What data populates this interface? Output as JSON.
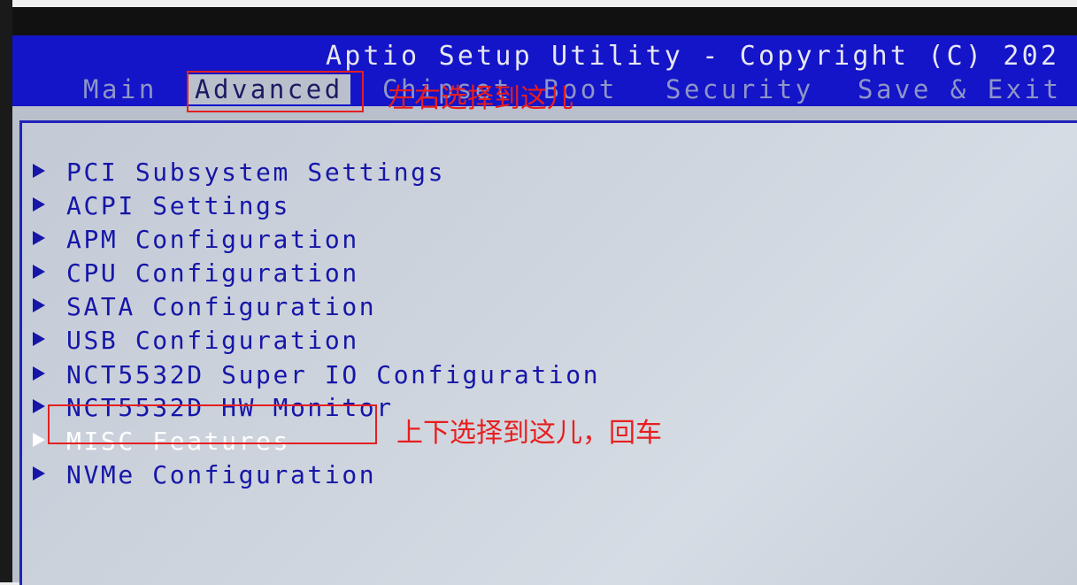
{
  "header": {
    "title": "Aptio Setup Utility - Copyright (C) 202"
  },
  "tabs": [
    "Main",
    "Advanced",
    "Chipset",
    "Boot",
    "Security",
    "Save & Exit"
  ],
  "menu": {
    "items": [
      "PCI Subsystem Settings",
      "ACPI Settings",
      "APM Configuration",
      "CPU Configuration",
      "SATA Configuration",
      "USB Configuration",
      "NCT5532D Super IO Configuration",
      "NCT5532D HW Monitor",
      "MISC Features",
      "NVMe Configuration"
    ],
    "selected_item": "MISC Features",
    "active_tab": "Advanced"
  },
  "annotations": {
    "tab_hint": "左右选择到这儿",
    "item_hint": "上下选择到这儿，回车"
  },
  "colors": {
    "header_bg": "#1414c8",
    "panel_bg": "#c6ccd7",
    "item_text": "#1616a8",
    "selected_text": "#ffffff",
    "annotation_red": "#e81e1e"
  },
  "icons": {
    "submenu_marker": "triangle-right-icon"
  }
}
